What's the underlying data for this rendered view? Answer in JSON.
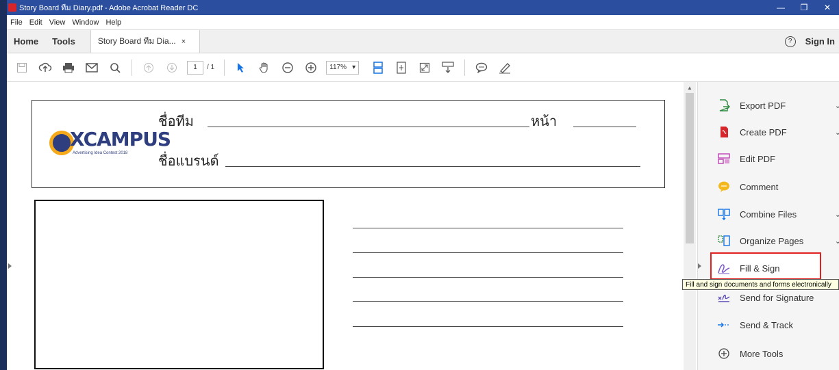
{
  "window": {
    "title": "Story Board ทีม Diary.pdf - Adobe Acrobat Reader DC",
    "min": "—",
    "restore": "❐",
    "close": "✕"
  },
  "menu": [
    "File",
    "Edit",
    "View",
    "Window",
    "Help"
  ],
  "tabs": {
    "home": "Home",
    "tools": "Tools",
    "doc": "Story Board ทีม Dia...",
    "doc_close": "×",
    "help": "?",
    "signin": "Sign In"
  },
  "toolbar": {
    "page_current": "1",
    "page_total": "/ 1",
    "zoom": "117%",
    "zoom_arrow": "▾"
  },
  "icons": {
    "save": "save-icon",
    "upload": "upload-icon",
    "print": "print-icon",
    "email": "email-icon",
    "search": "search-icon",
    "page_up": "page-up-icon",
    "page_down": "page-down-icon",
    "select": "select-arrow-icon",
    "hand": "hand-icon",
    "zoom_out": "zoom-out-icon",
    "zoom_in": "zoom-in-icon",
    "fit_width": "fit-width-icon",
    "fit_page": "fit-page-icon",
    "fullscreen": "fullscreen-icon",
    "scroll_mode": "scroll-mode-icon",
    "comment": "comment-icon",
    "highlight": "highlight-pen-icon"
  },
  "document": {
    "logo_text": "XCAMPUS",
    "logo_sub": "Advertising Idea Contest 2018",
    "team_label": "ชื่อทีม",
    "page_label": "หน้า",
    "brand_label": "ชื่อแบรนด์"
  },
  "tools_pane": {
    "items": [
      {
        "label": "Export PDF",
        "chevron": "⌄",
        "color": "#2d8a3e"
      },
      {
        "label": "Create PDF",
        "chevron": "⌄",
        "color": "#d6252b"
      },
      {
        "label": "Edit PDF",
        "chevron": "",
        "color": "#c13fb4"
      },
      {
        "label": "Comment",
        "chevron": "",
        "color": "#f2b81e"
      },
      {
        "label": "Combine Files",
        "chevron": "⌄",
        "color": "#1473e6"
      },
      {
        "label": "Organize Pages",
        "chevron": "⌄",
        "color": "#2d8a3e"
      },
      {
        "label": "Fill & Sign",
        "chevron": "",
        "color": "#7b57c6"
      },
      {
        "label": "Send for Signature",
        "chevron": "",
        "color": "#5e4bb5"
      },
      {
        "label": "Send & Track",
        "chevron": "",
        "color": "#1473e6"
      },
      {
        "label": "More Tools",
        "chevron": "",
        "color": "#444444"
      }
    ],
    "tooltip": "Fill and sign documents and forms electronically"
  }
}
